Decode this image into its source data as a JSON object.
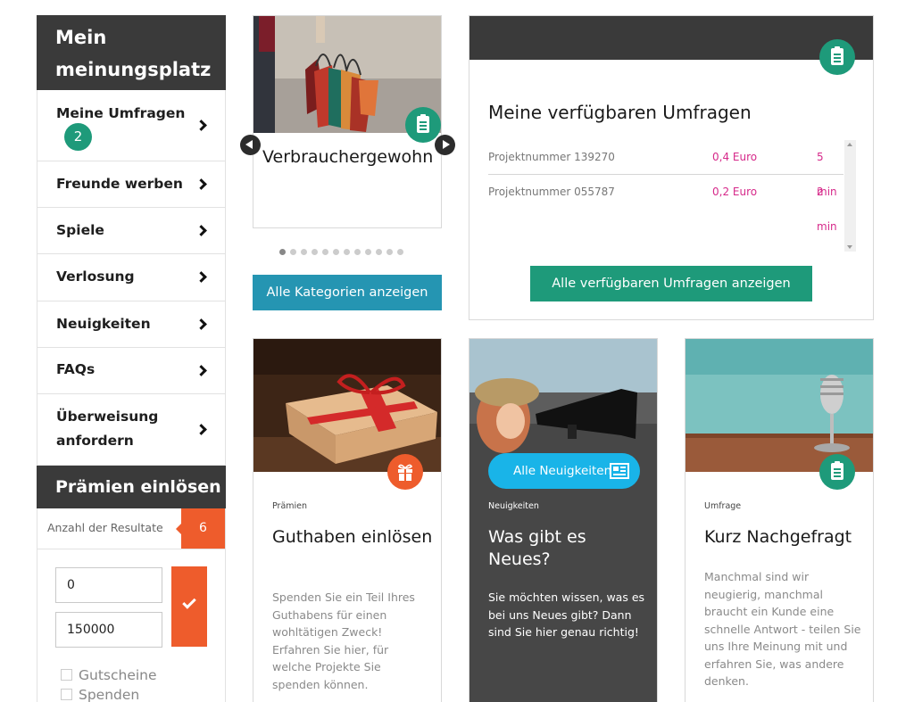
{
  "sidebar": {
    "title": "Mein meinungsplatz",
    "items": [
      {
        "label": "Meine Umfragen",
        "badge": "2"
      },
      {
        "label": "Freunde werben"
      },
      {
        "label": "Spiele"
      },
      {
        "label": "Verlosung"
      },
      {
        "label": "Neuigkeiten"
      },
      {
        "label": "FAQs"
      },
      {
        "label": "Überweisung anfordern"
      }
    ]
  },
  "rewards": {
    "title": "Prämien einlösen",
    "results_label": "Anzahl der Resultate",
    "results_count": "6",
    "min_value": "0",
    "max_value": "150000",
    "checkboxes": [
      "Gutscheine",
      "Spenden"
    ]
  },
  "category_slider": {
    "title": "Verbrauchergewohn",
    "dots_total": 12,
    "active_dot": 1,
    "button_label": "Alle Kategorien anzeigen"
  },
  "surveys": {
    "title": "Meine verfügbaren Umfragen",
    "rows": [
      {
        "project": "Projektnummer 139270",
        "payout": "0,4 Euro",
        "duration": "5 min"
      },
      {
        "project": "Projektnummer 055787",
        "payout": "0,2 Euro",
        "duration": "2 min"
      }
    ],
    "button_label": "Alle verfügbaren Umfragen anzeigen"
  },
  "cards": [
    {
      "category": "Prämien",
      "title": "Guthaben einlösen",
      "text": "Spenden Sie ein Teil Ihres Guthabens für einen wohltätigen Zweck! Erfahren Sie hier, für welche Projekte Sie spenden können."
    },
    {
      "category": "Neuigkeiten",
      "title": "Was gibt es Neues?",
      "text": "Sie möchten wissen, was es bei uns Neues gibt? Dann sind Sie hier genau richtig!",
      "button_label": "Alle Neuigkeiten"
    },
    {
      "category": "Umfrage",
      "title": "Kurz Nachgefragt",
      "text": "Manchmal sind wir neugierig, manchmal braucht ein Kunde eine schnelle Antwort - teilen Sie uns Ihre Meinung mit und erfahren Sie, was andere denken."
    }
  ],
  "colors": {
    "dark": "#3a3a3a",
    "teal": "#1e9a7a",
    "orange": "#ee5c2c",
    "blue": "#2595b2",
    "news_blue": "#19b4e8",
    "pink": "#d6298a"
  },
  "icons": [
    "chevron-right-icon",
    "clipboard-icon",
    "gift-icon",
    "newspaper-icon",
    "check-icon",
    "arrow-left-icon",
    "arrow-right-icon"
  ]
}
